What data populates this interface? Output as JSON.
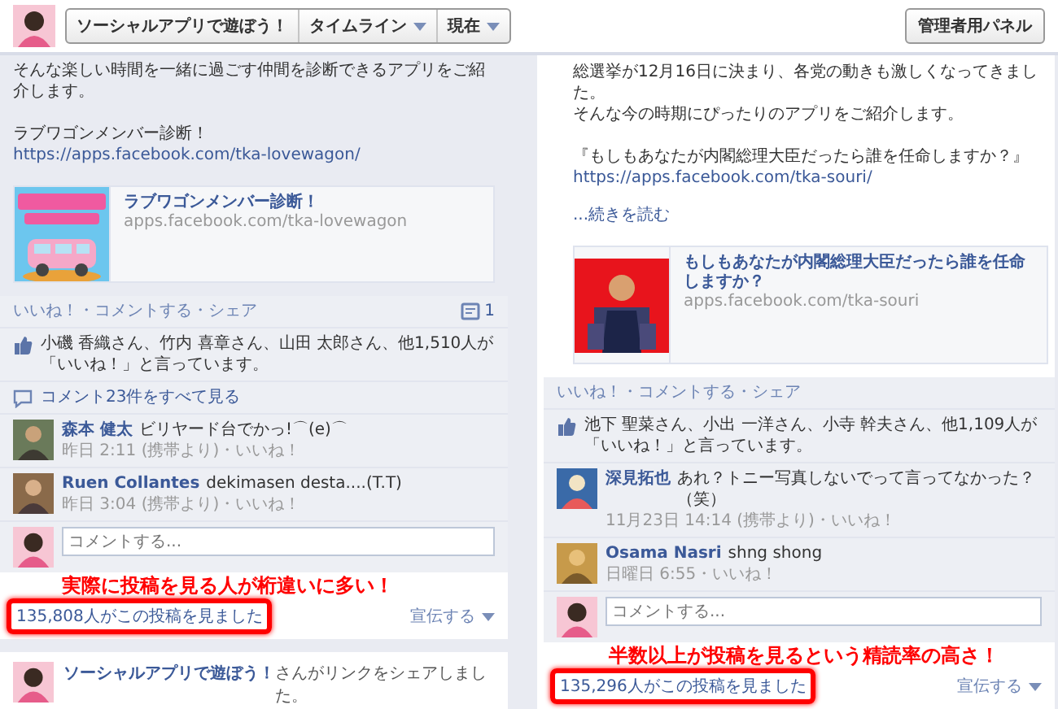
{
  "header": {
    "page_name": "ソーシャルアプリで遊ぼう！",
    "menus": [
      {
        "label": "タイムライン"
      },
      {
        "label": "現在"
      }
    ],
    "admin_button": "管理者用パネル"
  },
  "posts": [
    {
      "blocks": [
        {
          "lines": [
            "そんな楽しい時間を一緒に過ごす仲間を診断できるアプリをご紹介します。"
          ]
        },
        {
          "lines": [
            "ラブワゴンメンバー診断！"
          ]
        }
      ],
      "link": "https://apps.facebook.com/tka-lovewagon/",
      "preview": {
        "title": "ラブワゴンメンバー診断！",
        "domain": "apps.facebook.com/tka-lovewagon"
      },
      "feedback": {
        "actions": "いいね！・コメントする・シェア",
        "comment_count": "1",
        "likes": "小磯 香織さん、竹内 喜章さん、山田 太郎さん、他1,510人が「いいね！」と言っています。",
        "view_all": "コメント23件をすべて見る",
        "comments": [
          {
            "author": "森本 健太",
            "text": "ビリヤード台でかっ!⌒(e)⌒",
            "meta": "昨日 2:11 (携帯より)・いいね！"
          },
          {
            "author": "Ruen Collantes",
            "text": "dekimasen desta....(T.T)",
            "meta": "昨日 3:04 (携帯より)・いいね！"
          }
        ],
        "placeholder": "コメントする...",
        "views": "135,808人がこの投稿を見ました",
        "promote": "宣伝する"
      },
      "annotation": "実際に投稿を見る人が桁違いに多い！"
    },
    {
      "blocks": [
        {
          "lines": [
            "総選挙が12月16日に決まり、各党の動きも激しくなってきました。",
            "そんな今の時期にぴったりのアプリをご紹介します。"
          ]
        },
        {
          "lines": [
            "『もしもあなたが内閣総理大臣だったら誰を任命しますか？』"
          ]
        }
      ],
      "link": "https://apps.facebook.com/tka-souri/",
      "read_more": "...続きを読む",
      "preview": {
        "title": "もしもあなたが内閣総理大臣だったら誰を任命しますか？",
        "domain": "apps.facebook.com/tka-souri"
      },
      "feedback": {
        "actions": "いいね！・コメントする・シェア",
        "likes": "池下 聖菜さん、小出 一洋さん、小寺 幹夫さん、他1,109人が「いいね！」と言っています。",
        "comments": [
          {
            "author": "深見拓也",
            "text": "あれ？トニー写真しないでって言ってなかった？（笑）",
            "meta": "11月23日 14:14 (携帯より)・いいね！"
          },
          {
            "author": "Osama Nasri",
            "text": "shng shong",
            "meta": "日曜日 6:55・いいね！"
          }
        ],
        "placeholder": "コメントする...",
        "views": "135,296人がこの投稿を見ました",
        "promote": "宣伝する"
      },
      "annotation": "半数以上が投稿を見るという精読率の高さ！"
    }
  ],
  "next_post": {
    "author": "ソーシャルアプリで遊ぼう！",
    "text": "さんがリンクをシェアしました。"
  }
}
